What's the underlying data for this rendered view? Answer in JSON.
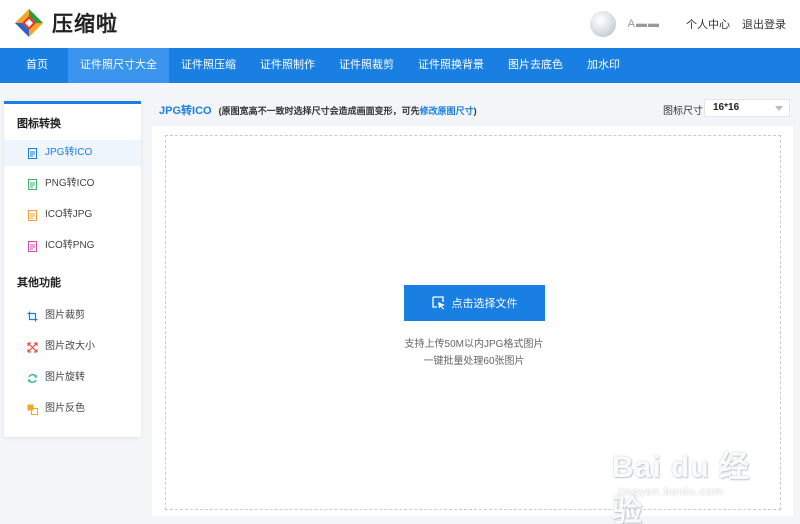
{
  "app": {
    "logo_text": "压缩啦"
  },
  "user": {
    "name": "A▬▬",
    "links": [
      "个人中心",
      "退出登录"
    ]
  },
  "nav": {
    "items": [
      {
        "label": "首页",
        "active": false
      },
      {
        "label": "证件照尺寸大全",
        "active": true
      },
      {
        "label": "证件照压缩",
        "active": false
      },
      {
        "label": "证件照制作",
        "active": false
      },
      {
        "label": "证件照裁剪",
        "active": false
      },
      {
        "label": "证件照换背景",
        "active": false
      },
      {
        "label": "图片去底色",
        "active": false
      },
      {
        "label": "加水印",
        "active": false
      }
    ]
  },
  "sidebar": {
    "section1": "图标转换",
    "convert_items": [
      {
        "label": "JPG转ICO",
        "icon": "jpg-file-icon",
        "active": true
      },
      {
        "label": "PNG转ICO",
        "icon": "png-file-icon",
        "active": false
      },
      {
        "label": "ICO转JPG",
        "icon": "ico-file-icon",
        "active": false
      },
      {
        "label": "ICO转PNG",
        "icon": "ico-png-file-icon",
        "active": false
      }
    ],
    "section2": "其他功能",
    "other_items": [
      {
        "label": "图片裁剪",
        "icon": "crop-icon"
      },
      {
        "label": "图片改大小",
        "icon": "resize-icon"
      },
      {
        "label": "图片旋转",
        "icon": "rotate-icon"
      },
      {
        "label": "图片反色",
        "icon": "invert-icon"
      }
    ]
  },
  "main": {
    "title": "JPG转ICO",
    "note_prefix": "(原图宽高不一致时选择尺寸会造成画面变形，可先",
    "note_link": "修改原图尺寸",
    "note_suffix": ")",
    "size_label": "图标尺寸",
    "size_value": "16*16",
    "upload_label": "点击选择文件",
    "hint1": "支持上传50M以内JPG格式图片",
    "hint2": "一键批量处理60张图片"
  },
  "watermark": {
    "main": "Bai du 经验",
    "sub": "jingyan.baidu.com"
  },
  "colors": {
    "accent": "#1a7fe3",
    "nav_active": "#3b95ee"
  }
}
